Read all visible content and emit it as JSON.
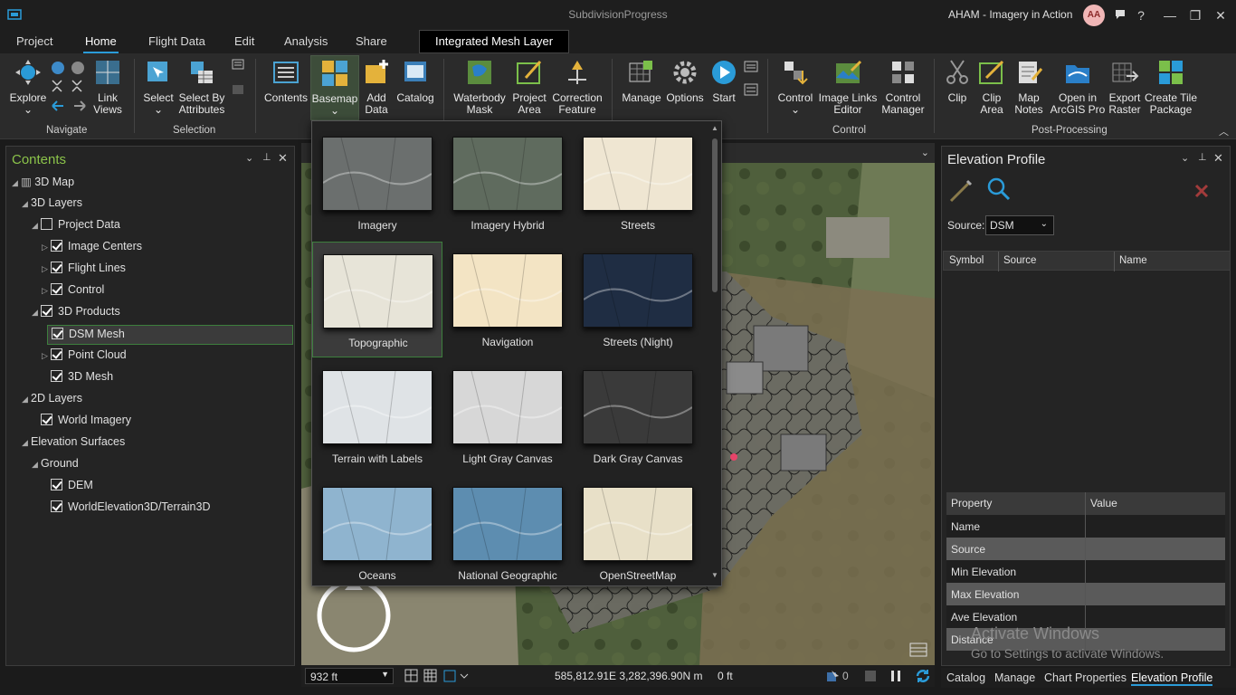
{
  "titlebar": {
    "doc_title": "SubdivisionProgress",
    "user": "AHAM - Imagery in Action",
    "avatar": "AA",
    "help": "?",
    "minimize": "—",
    "restore": "❐",
    "close": "✕"
  },
  "tabs": [
    "Project",
    "Home",
    "Flight Data",
    "Edit",
    "Analysis",
    "Share"
  ],
  "contextual_tab": "Integrated Mesh Layer",
  "ribbon": {
    "navigate": {
      "label": "Navigate",
      "explore": "Explore",
      "link_views": "Link Views"
    },
    "selection": {
      "label": "Selection",
      "select": "Select",
      "select_by_attributes": "Select By Attributes"
    },
    "layer": {
      "contents": "Contents",
      "basemap": "Basemap",
      "add_data": "Add Data",
      "catalog": "Catalog"
    },
    "flight": {
      "waterbody_mask": "Waterbody Mask",
      "project_area": "Project Area",
      "correction_feature": "Correction Feature"
    },
    "tools": {
      "manage": "Manage",
      "options": "Options",
      "start": "Start"
    },
    "control": {
      "label": "Control",
      "control": "Control",
      "image_links_editor": "Image Links Editor",
      "control_manager": "Control Manager"
    },
    "post": {
      "label": "Post-Processing",
      "clip": "Clip",
      "clip_area": "Clip Area",
      "map_notes": "Map Notes",
      "open_in_arcgis_pro": "Open in ArcGIS Pro",
      "export_raster": "Export Raster",
      "create_tile_package": "Create Tile Package"
    }
  },
  "contents": {
    "title": "Contents",
    "items": [
      {
        "label": "3D Map",
        "level": 0,
        "exp": "◢",
        "chk": null
      },
      {
        "label": "3D Layers",
        "level": 1,
        "exp": "◢",
        "chk": null
      },
      {
        "label": "Project Data",
        "level": 2,
        "exp": "◢",
        "chk": "off"
      },
      {
        "label": "Image Centers",
        "level": 3,
        "exp": "▷",
        "chk": "on"
      },
      {
        "label": "Flight Lines",
        "level": 3,
        "exp": "▷",
        "chk": "on"
      },
      {
        "label": "Control",
        "level": 3,
        "exp": "▷",
        "chk": "on"
      },
      {
        "label": "3D Products",
        "level": 2,
        "exp": "◢",
        "chk": "on"
      },
      {
        "label": "DSM Mesh",
        "level": 3,
        "exp": "",
        "chk": "on",
        "selected": true
      },
      {
        "label": "Point Cloud",
        "level": 3,
        "exp": "▷",
        "chk": "on"
      },
      {
        "label": "3D Mesh",
        "level": 3,
        "exp": "",
        "chk": "on"
      },
      {
        "label": "2D Layers",
        "level": 1,
        "exp": "◢",
        "chk": null
      },
      {
        "label": "World Imagery",
        "level": 2,
        "exp": "",
        "chk": "on"
      },
      {
        "label": "Elevation Surfaces",
        "level": 1,
        "exp": "◢",
        "chk": null
      },
      {
        "label": "Ground",
        "level": 2,
        "exp": "◢",
        "chk": null
      },
      {
        "label": "DEM",
        "level": 3,
        "exp": "",
        "chk": "on"
      },
      {
        "label": "WorldElevation3D/Terrain3D",
        "level": 3,
        "exp": "",
        "chk": "on"
      }
    ]
  },
  "basemaps": [
    {
      "label": "Imagery",
      "color": "#6b6f6e"
    },
    {
      "label": "Imagery Hybrid",
      "color": "#5f6b5e"
    },
    {
      "label": "Streets",
      "color": "#efe6d2"
    },
    {
      "label": "Topographic",
      "color": "#e7e4d8",
      "selected": true
    },
    {
      "label": "Navigation",
      "color": "#f3e4c4"
    },
    {
      "label": "Streets (Night)",
      "color": "#1f2d43"
    },
    {
      "label": "Terrain with Labels",
      "color": "#dfe3e6"
    },
    {
      "label": "Light Gray Canvas",
      "color": "#d7d7d7"
    },
    {
      "label": "Dark Gray Canvas",
      "color": "#3a3a3a"
    },
    {
      "label": "Oceans",
      "color": "#8fb4cf"
    },
    {
      "label": "National Geographic",
      "color": "#5d8db0"
    },
    {
      "label": "OpenStreetMap",
      "color": "#e8e0c8"
    }
  ],
  "statusbar": {
    "scale": "932 ft",
    "coordinates": "585,812.91E 3,282,396.90N m",
    "elevation": "0 ft",
    "count": "0"
  },
  "elevation_profile": {
    "title": "Elevation Profile",
    "source_label": "Source:",
    "source_value": "DSM",
    "columns": [
      "Symbol",
      "Source",
      "Name"
    ],
    "prop_header": [
      "Property",
      "Value"
    ],
    "properties": [
      "Name",
      "Source",
      "Min Elevation",
      "Max Elevation",
      "Ave Elevation",
      "Distance"
    ]
  },
  "bottom_tabs": [
    "Catalog",
    "Manage",
    "Chart Properties",
    "Elevation Profile"
  ],
  "watermark": {
    "line1": "Activate Windows",
    "line2": "Go to Settings to activate Windows."
  }
}
